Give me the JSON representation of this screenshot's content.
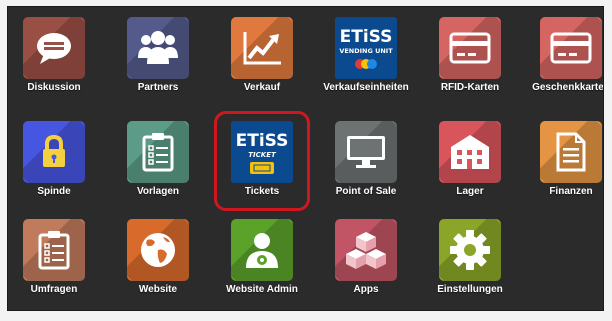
{
  "apps": [
    {
      "id": "diskussion",
      "label": "Diskussion",
      "color": "#9a4f45",
      "icon": "chat-bubble-icon"
    },
    {
      "id": "partners",
      "label": "Partners",
      "color": "#545b8a",
      "icon": "people-icon"
    },
    {
      "id": "verkauf",
      "label": "Verkauf",
      "color": "#e0793d",
      "icon": "trend-chart-icon"
    },
    {
      "id": "verkaufseinheiten",
      "label": "Verkaufseinheiten",
      "color": "#0b4a8e",
      "icon": "etiss-vending-logo"
    },
    {
      "id": "rfid-karten",
      "label": "RFID-Karten",
      "color": "#d46561",
      "icon": "card-icon"
    },
    {
      "id": "geschenkkarten",
      "label": "Geschenkkarten",
      "color": "#d46561",
      "icon": "card-icon"
    },
    {
      "id": "spinde",
      "label": "Spinde",
      "color": "#4756e0",
      "icon": "lock-icon"
    },
    {
      "id": "vorlagen",
      "label": "Vorlagen",
      "color": "#5b9b87",
      "icon": "clipboard-list-icon"
    },
    {
      "id": "tickets",
      "label": "Tickets",
      "color": "#0b4a8e",
      "icon": "etiss-ticket-logo"
    },
    {
      "id": "point-of-sale",
      "label": "Point of Sale",
      "color": "#6d7273",
      "icon": "monitor-icon"
    },
    {
      "id": "lager",
      "label": "Lager",
      "color": "#d9555c",
      "icon": "warehouse-icon"
    },
    {
      "id": "finanzen",
      "label": "Finanzen",
      "color": "#e59443",
      "icon": "document-icon"
    },
    {
      "id": "umfragen",
      "label": "Umfragen",
      "color": "#c07b5c",
      "icon": "clipboard-list-icon"
    },
    {
      "id": "website",
      "label": "Website",
      "color": "#d86b2c",
      "icon": "globe-icon"
    },
    {
      "id": "website-admin",
      "label": "Website Admin",
      "color": "#5ba22b",
      "icon": "user-gear-icon"
    },
    {
      "id": "apps",
      "label": "Apps",
      "color": "#c15565",
      "icon": "cubes-icon"
    },
    {
      "id": "einstellungen",
      "label": "Einstellungen",
      "color": "#8aa528",
      "icon": "gear-icon"
    }
  ],
  "etiss": {
    "brand": "ETiSS",
    "vending_caption": "VENDING UNIT",
    "ticket_caption": "TICKET"
  },
  "highlight_color": "#d0171f"
}
